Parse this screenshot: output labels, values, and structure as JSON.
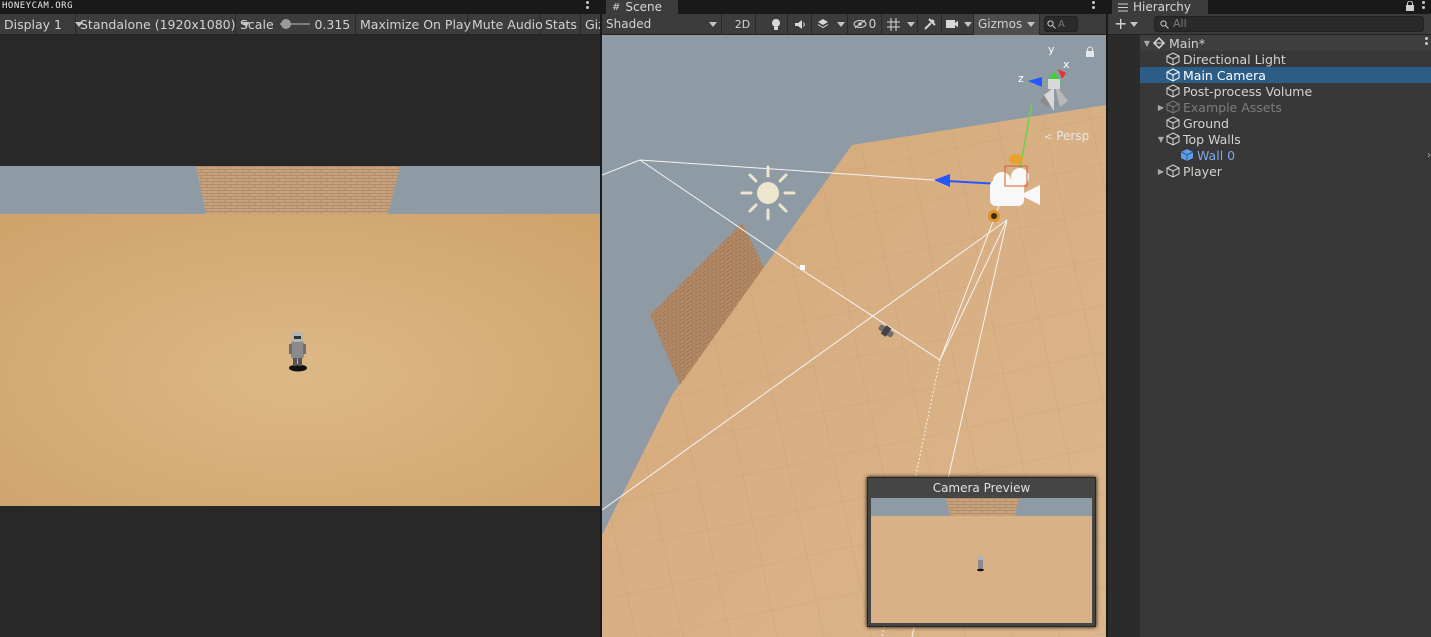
{
  "watermark": "HONEYCAM.ORG",
  "game": {
    "display_label": "Display 1",
    "resolution_label": "Standalone (1920x1080)",
    "scale_label": "Scale",
    "scale_value": "0.315x",
    "scale_fraction": 0.08,
    "maximize_label": "Maximize On Play",
    "mute_label": "Mute Audio",
    "stats_label": "Stats",
    "gizmos_label": "Giz"
  },
  "scene": {
    "tab_label": "Scene",
    "shading_label": "Shaded",
    "mode_2d_label": "2D",
    "hidden_count": "0",
    "gizmos_label": "Gizmos",
    "search_placeholder": "A",
    "persp_label": "Persp",
    "axis_labels": {
      "y": "y",
      "z": "z",
      "x": "x"
    },
    "preview_title": "Camera Preview"
  },
  "hierarchy": {
    "tab_label": "Hierarchy",
    "search_placeholder": "All",
    "root": "Main*",
    "items": [
      {
        "label": "Directional Light"
      },
      {
        "label": "Main Camera"
      },
      {
        "label": "Post-process Volume"
      },
      {
        "label": "Example Assets"
      },
      {
        "label": "Ground"
      },
      {
        "label": "Top Walls"
      },
      {
        "label": "Wall 0"
      },
      {
        "label": "Player"
      }
    ]
  },
  "colors": {
    "ground": "#d7ad78",
    "sky": "#8e9aa4",
    "selection": "#2c5d87",
    "prefab_text": "#7fa6ea"
  },
  "icons": {
    "hierarchy_tab": "list-icon",
    "scene_tab": "grid-icon",
    "light": "light-bulb-icon",
    "audio": "speaker-icon",
    "effects": "layers-icon",
    "hidden": "eye-slash-icon",
    "grid": "grid-toggle-icon",
    "tools": "wrench-icon",
    "camera": "camera-icon",
    "search": "search-icon",
    "add": "plus-icon",
    "lock": "lock-icon",
    "game_object": "cube-icon",
    "unity_scene": "unity-logo-icon"
  }
}
